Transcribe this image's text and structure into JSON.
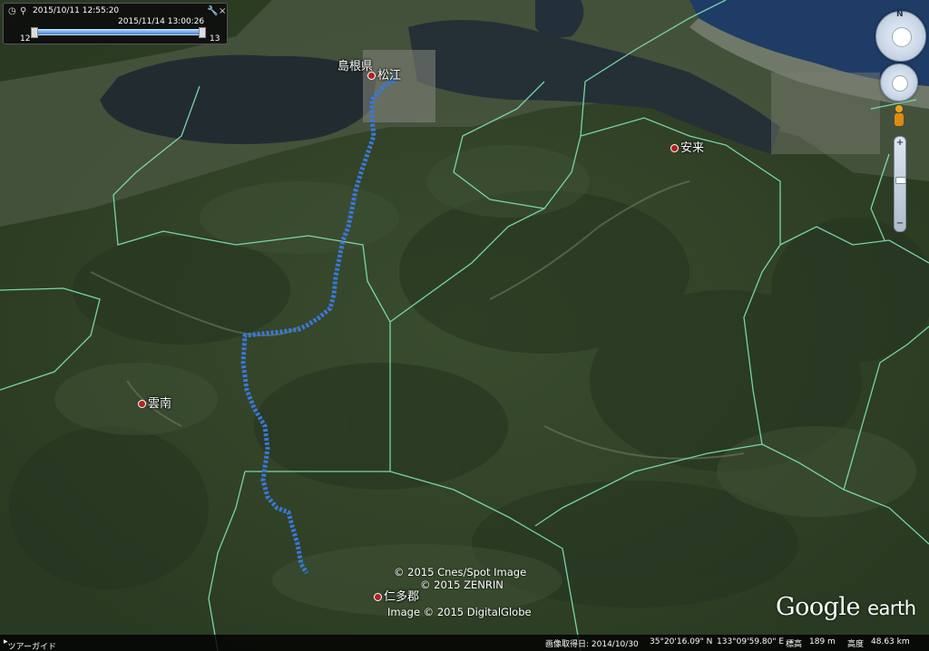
{
  "timeslider": {
    "start_date": "2015/10/11  12:55:20",
    "end_date": "2015/11/14  13:00:26",
    "range_left": "12",
    "range_right": "13"
  },
  "places": [
    {
      "id": "shimane",
      "label": "島根県"
    },
    {
      "id": "matsue",
      "label": "松江"
    },
    {
      "id": "yasugi",
      "label": "安来"
    },
    {
      "id": "unnan",
      "label": "雲南"
    },
    {
      "id": "nita",
      "label": "仁多郡"
    }
  ],
  "credits": {
    "line1": "© 2015 Cnes/Spot Image",
    "line2": "© 2015 ZENRIN",
    "line3": "Image © 2015 DigitalGlobe"
  },
  "logo": {
    "google": "Google",
    "earth": "earth"
  },
  "statusbar": {
    "tour_guide": "ツアーガイド",
    "image_date": "画像取得日: 2014/10/30",
    "lat": "35°20'16.09\" N",
    "lon": "133°09'59.80\" E",
    "elev_label": "標高",
    "elev_value": "189 m",
    "eye_label": "高度",
    "eye_value": "48.63 km"
  },
  "nav": {
    "north": "N"
  },
  "zoom": {
    "plus": "+",
    "minus": "−"
  },
  "colors": {
    "track": "#3a78d8",
    "boundary": "#7fe6b8",
    "water": "#23303a",
    "sea": "#1f3c66"
  }
}
